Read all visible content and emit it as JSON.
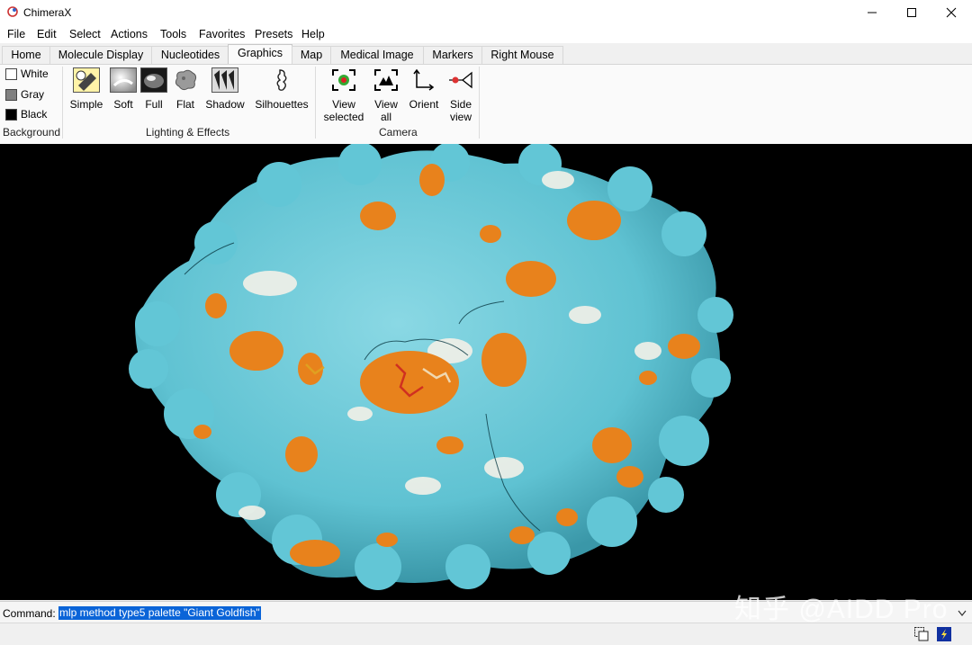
{
  "window": {
    "title": "ChimeraX"
  },
  "menu": [
    "File",
    "Edit",
    "Select",
    "Actions",
    "Tools",
    "Favorites",
    "Presets",
    "Help"
  ],
  "tabs": [
    "Home",
    "Molecule Display",
    "Nucleotides",
    "Graphics",
    "Map",
    "Medical Image",
    "Markers",
    "Right Mouse"
  ],
  "active_tab": "Graphics",
  "background": {
    "options": [
      "White",
      "Gray",
      "Black"
    ],
    "colors": [
      "#ffffff",
      "#808080",
      "#000000"
    ],
    "group_label": "Background"
  },
  "lighting": {
    "buttons": [
      "Simple",
      "Soft",
      "Full",
      "Flat",
      "Shadow",
      "Silhouettes"
    ],
    "group_label": "Lighting & Effects"
  },
  "camera": {
    "buttons": [
      [
        "View",
        "selected"
      ],
      [
        "View",
        "all"
      ],
      [
        "Orient",
        ""
      ],
      [
        "Side",
        "view"
      ]
    ],
    "group_label": "Camera"
  },
  "command": {
    "label": "Command:",
    "value": "mlp method type5 palette \"Giant Goldfish\""
  },
  "watermark": "知乎 @AIDD Pro",
  "surface_colors": {
    "hydrophilic": "#67c9d8",
    "neutral": "#f2f2ec",
    "hydrophobic": "#e8821c"
  }
}
